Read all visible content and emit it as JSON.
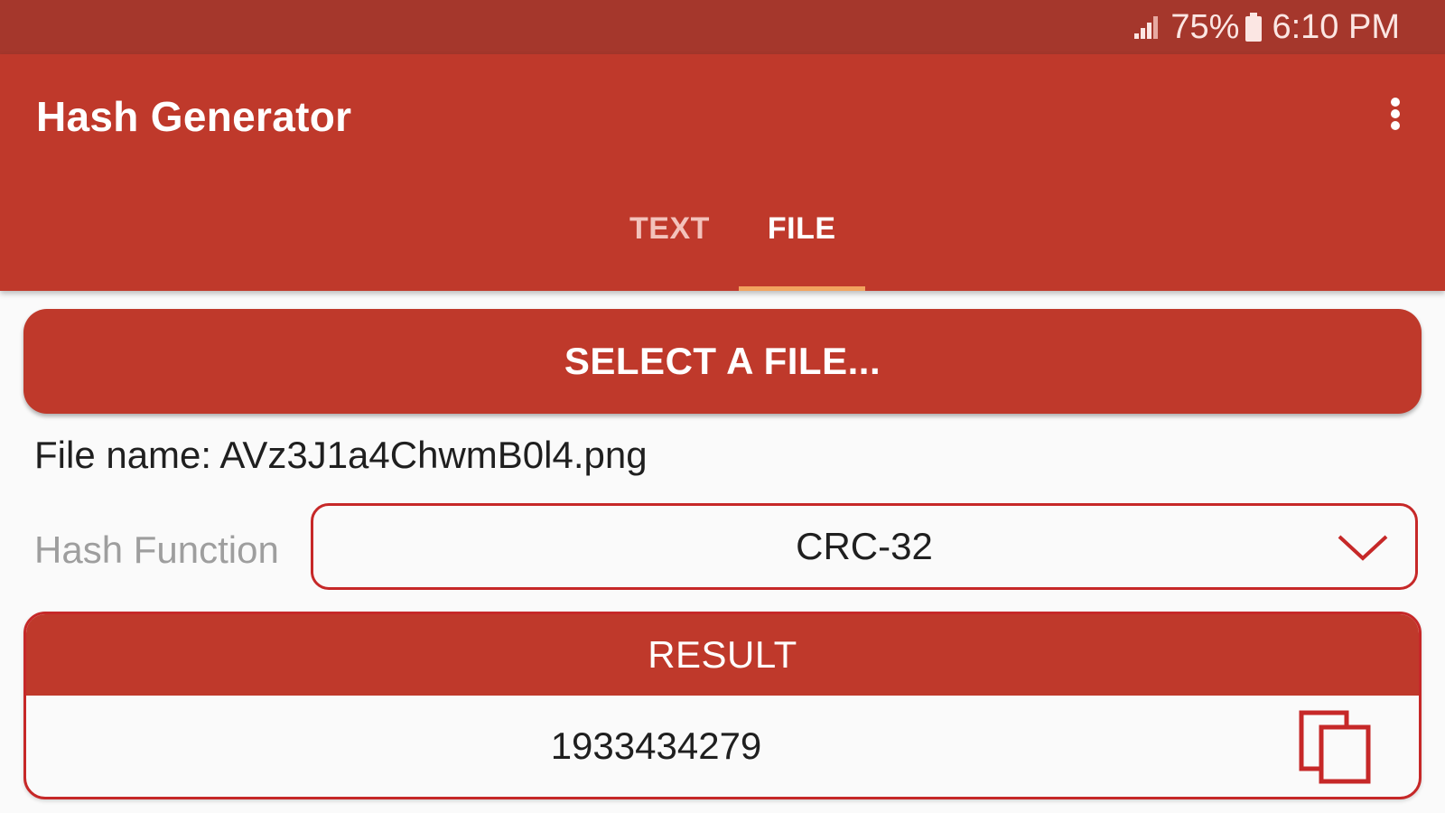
{
  "status_bar": {
    "battery": "75%",
    "time": "6:10 PM",
    "icons": [
      "signal-icon",
      "battery-icon"
    ]
  },
  "app_bar": {
    "title": "Hash Generator",
    "menu_icon": "more-vert-icon"
  },
  "tabs": [
    {
      "label": "TEXT",
      "active": false
    },
    {
      "label": "FILE",
      "active": true
    }
  ],
  "file_tab": {
    "select_button_label": "SELECT A FILE...",
    "file_name_text": "File name: AVz3J1a4ChwmB0l4.png",
    "hash_function_label": "Hash Function",
    "hash_function_selected": "CRC-32",
    "result_header": "RESULT",
    "result_value": "1933434279",
    "copy_icon": "copy-icon",
    "dropdown_icon": "chevron-down-icon"
  },
  "colors": {
    "status_bar": "#a5372c",
    "primary": "#bf392b",
    "accent_indicator": "#f2a35f",
    "border": "#c62828",
    "background": "#fafafa"
  }
}
